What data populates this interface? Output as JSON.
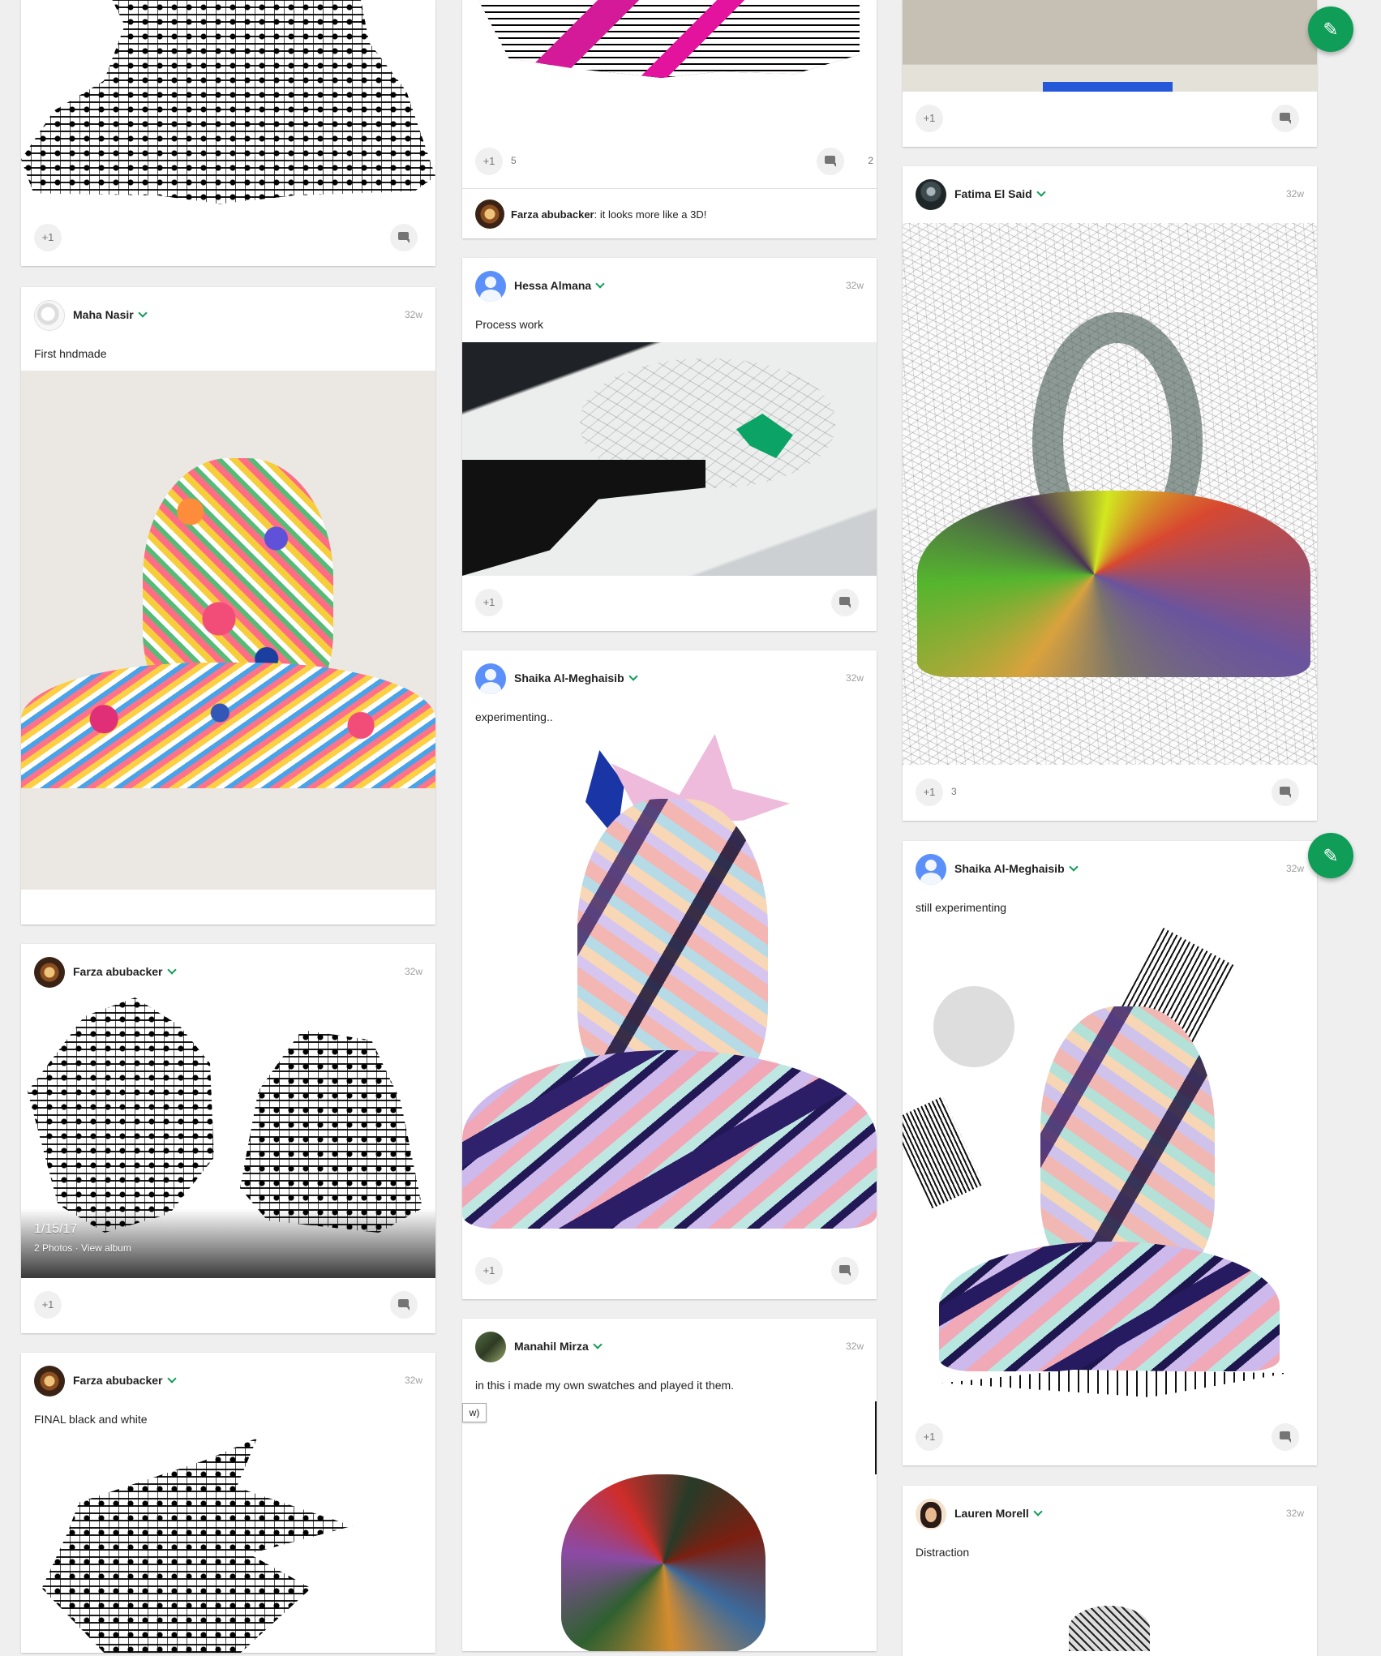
{
  "posts": [
    {
      "author": "Maha Nasir",
      "time": "32w",
      "text": "First hndmade",
      "plus": "+1"
    },
    {
      "author": "Farza abubacker",
      "time": "32w",
      "album_date": "1/15/17",
      "album_meta": "2 Photos · View album",
      "plus": "+1"
    },
    {
      "author": "Farza abubacker",
      "time": "32w",
      "text": "FINAL black and white"
    },
    {
      "author": "Hessa Almana",
      "time": "32w",
      "text": "Process work",
      "plus": "+1"
    },
    {
      "author": "Shaika Al-Meghaisib",
      "time": "32w",
      "text": "experimenting..",
      "plus": "+1"
    },
    {
      "author": "Manahil Mirza",
      "time": "32w",
      "text": "in this i made my own swatches and played it them.",
      "tooltip": "w)"
    },
    {
      "author": "Fatima El Said",
      "time": "32w",
      "plus": "+1",
      "plus_count": "3"
    },
    {
      "author": "Shaika Al-Meghaisib",
      "time": "32w",
      "text": "still experimenting",
      "plus": "+1"
    },
    {
      "author": "Lauren Morell",
      "time": "32w",
      "text": "Distraction"
    }
  ],
  "top_cards": {
    "left_plus": "+1",
    "middle_plus": "+1",
    "middle_plus_count": "5",
    "middle_comment_count": "2",
    "middle_comment_author": "Farza abubacker",
    "middle_comment_text": ": it looks more like a 3D!",
    "right_plus": "+1"
  },
  "fab_icon": "pencil-icon",
  "colors": {
    "accent": "#0f9d58",
    "background": "#efefef"
  }
}
